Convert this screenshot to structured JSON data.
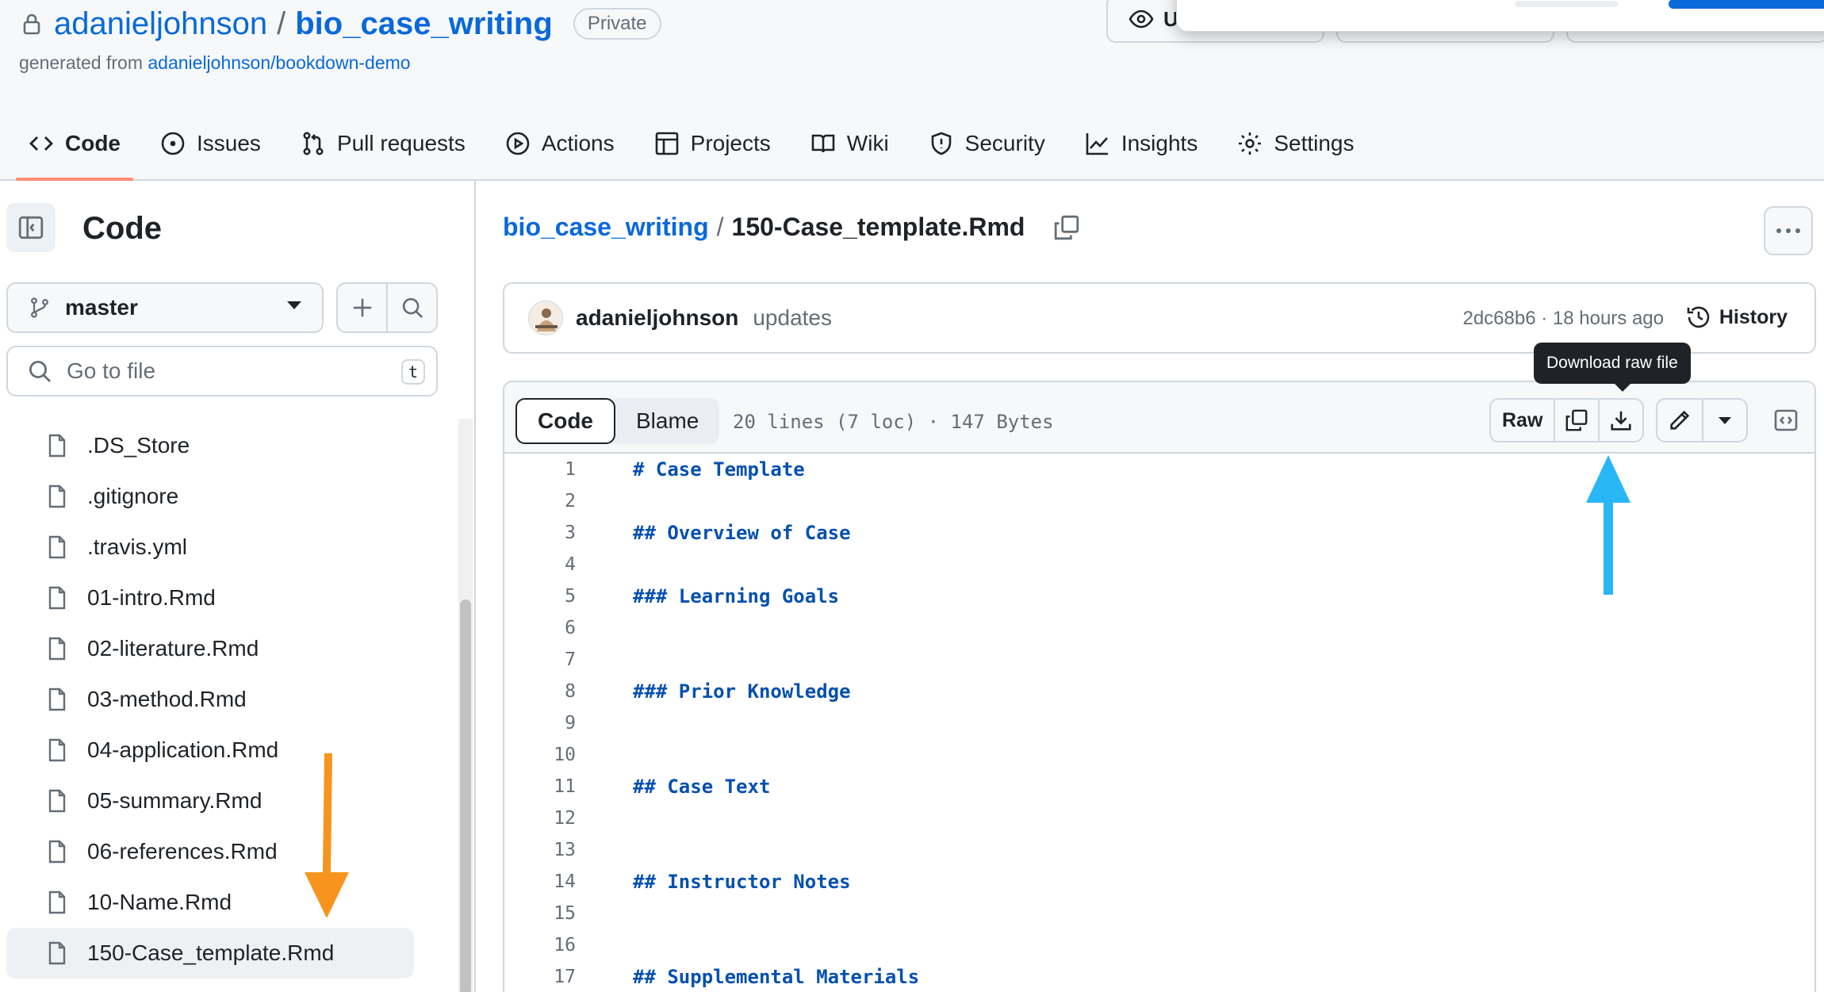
{
  "repo": {
    "owner": "adanieljohnson",
    "separator": "/",
    "name": "bio_case_writing",
    "visibility": "Private",
    "generated_prefix": "generated from ",
    "generated_link": "adanieljohnson/bookdown-demo",
    "watch_label": "U"
  },
  "tabs": [
    {
      "label": "Code",
      "icon": "code-icon",
      "active": true
    },
    {
      "label": "Issues",
      "icon": "issue-icon"
    },
    {
      "label": "Pull requests",
      "icon": "pull-request-icon"
    },
    {
      "label": "Actions",
      "icon": "play-icon"
    },
    {
      "label": "Projects",
      "icon": "table-icon"
    },
    {
      "label": "Wiki",
      "icon": "book-icon"
    },
    {
      "label": "Security",
      "icon": "shield-icon"
    },
    {
      "label": "Insights",
      "icon": "graph-icon"
    },
    {
      "label": "Settings",
      "icon": "gear-icon"
    }
  ],
  "sidebar": {
    "title": "Code",
    "branch": "master",
    "search_placeholder": "Go to file",
    "search_shortcut": "t",
    "files": [
      ".DS_Store",
      ".gitignore",
      ".travis.yml",
      "01-intro.Rmd",
      "02-literature.Rmd",
      "03-method.Rmd",
      "04-application.Rmd",
      "05-summary.Rmd",
      "06-references.Rmd",
      "10-Name.Rmd",
      "150-Case_template.Rmd"
    ],
    "selected_file": "150-Case_template.Rmd"
  },
  "breadcrumb": {
    "repo": "bio_case_writing",
    "separator": "/",
    "file": "150-Case_template.Rmd"
  },
  "commit": {
    "author": "adanieljohnson",
    "message": "updates",
    "meta": "2dc68b6 · 18 hours ago",
    "history_label": "History"
  },
  "file_view": {
    "tab_code": "Code",
    "tab_blame": "Blame",
    "info": "20 lines (7 loc) · 147 Bytes",
    "raw_label": "Raw",
    "tooltip": "Download raw file",
    "lines": [
      {
        "n": "1",
        "text": "# Case Template"
      },
      {
        "n": "2",
        "text": ""
      },
      {
        "n": "3",
        "text": "## Overview of Case"
      },
      {
        "n": "4",
        "text": ""
      },
      {
        "n": "5",
        "text": "### Learning Goals"
      },
      {
        "n": "6",
        "text": ""
      },
      {
        "n": "7",
        "text": ""
      },
      {
        "n": "8",
        "text": "### Prior Knowledge"
      },
      {
        "n": "9",
        "text": ""
      },
      {
        "n": "10",
        "text": ""
      },
      {
        "n": "11",
        "text": "## Case Text"
      },
      {
        "n": "12",
        "text": ""
      },
      {
        "n": "13",
        "text": ""
      },
      {
        "n": "14",
        "text": "## Instructor Notes"
      },
      {
        "n": "15",
        "text": ""
      },
      {
        "n": "16",
        "text": ""
      },
      {
        "n": "17",
        "text": "## Supplemental Materials"
      }
    ]
  },
  "colors": {
    "link": "#0969da",
    "tab_underline": "#fd8c73",
    "code_keyword": "#0550ae",
    "annotation_orange": "#f7941d",
    "annotation_blue": "#29b6f6"
  }
}
